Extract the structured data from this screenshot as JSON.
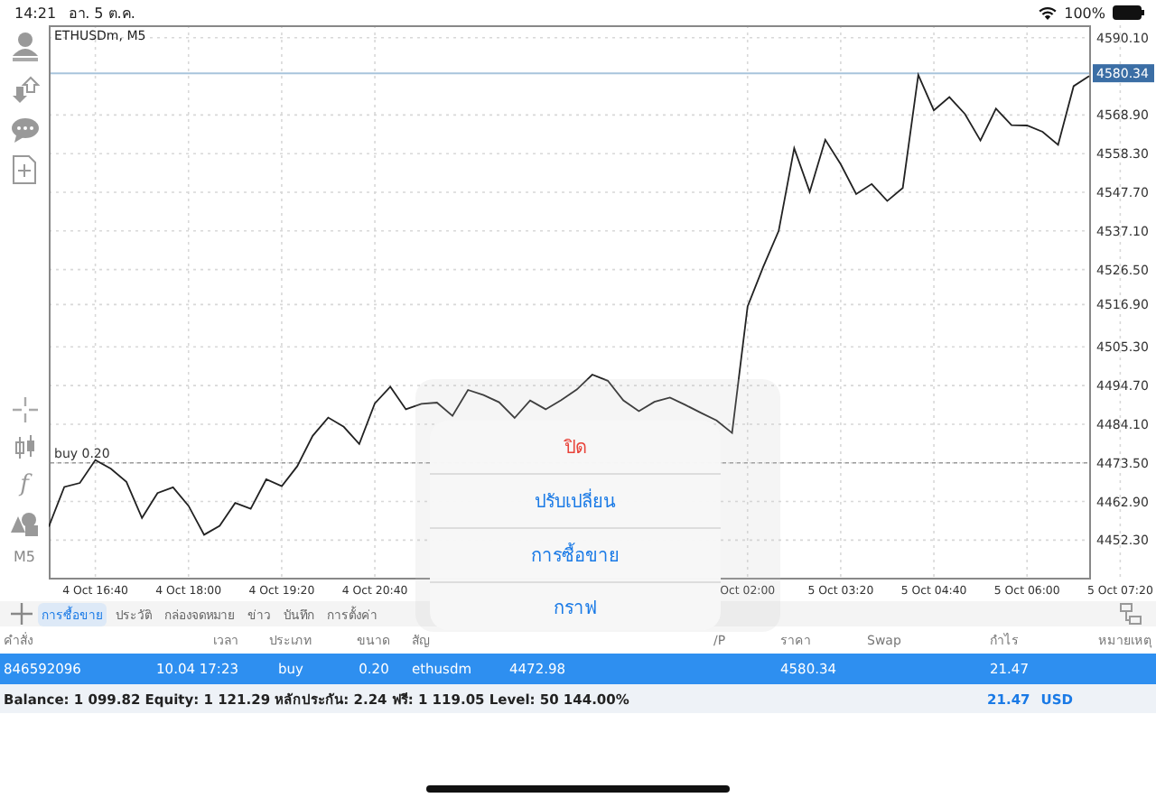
{
  "status_bar": {
    "time": "14:21",
    "date": "อา. 5 ต.ค.",
    "battery": "100%"
  },
  "left_toolbar": {
    "function_glyph": "f",
    "timeframe": "M5"
  },
  "chart": {
    "chart_data": {
      "type": "line",
      "title": "ETHUSDm, M5",
      "grid": true,
      "ylim": [
        4442,
        4593
      ],
      "categories": [
        null,
        null,
        null,
        "4 Oct 16:40",
        null,
        null,
        null,
        null,
        null,
        "4 Oct 18:00",
        null,
        null,
        null,
        null,
        null,
        "4 Oct 19:20",
        null,
        null,
        null,
        null,
        null,
        "4 Oct 20:40",
        null,
        null,
        null,
        null,
        null,
        null,
        null,
        null,
        null,
        null,
        null,
        null,
        null,
        null,
        null,
        null,
        null,
        null,
        null,
        null,
        null,
        null,
        null,
        "Oct 02:00",
        null,
        null,
        null,
        null,
        null,
        "5 Oct 03:20",
        null,
        null,
        null,
        null,
        null,
        "5 Oct 04:40",
        null,
        null,
        null,
        null,
        null,
        "5 Oct 06:00",
        null,
        null,
        null,
        null,
        null,
        "5 Oct 07:20"
      ],
      "yticks": [
        {
          "value": 4590.1,
          "label": "4590.10"
        },
        {
          "value": 4568.9,
          "label": "4568.90"
        },
        {
          "value": 4558.3,
          "label": "4558.30"
        },
        {
          "value": 4547.7,
          "label": "4547.70"
        },
        {
          "value": 4537.1,
          "label": "4537.10"
        },
        {
          "value": 4526.5,
          "label": "4526.50"
        },
        {
          "value": 4516.9,
          "label": "4516.90"
        },
        {
          "value": 4505.3,
          "label": "4505.30"
        },
        {
          "value": 4494.7,
          "label": "4494.70"
        },
        {
          "value": 4484.1,
          "label": "4484.10"
        },
        {
          "value": 4473.5,
          "label": "4473.50"
        },
        {
          "value": 4462.9,
          "label": "4462.90"
        },
        {
          "value": 4452.3,
          "label": "4452.30"
        }
      ],
      "ref_lines": [
        {
          "axis": "y",
          "value": 4473.5,
          "label": "buy 0.20"
        },
        {
          "axis": "y",
          "value": 4580.34,
          "label": "4580.34"
        }
      ],
      "series": [
        {
          "color": "#222222",
          "values": [
            4456.0,
            4466.9,
            4468.0,
            4474.3,
            4471.9,
            4468.3,
            4458.4,
            4465.2,
            4466.8,
            4461.7,
            4453.8,
            4456.2,
            4462.5,
            4460.9,
            4469.0,
            4467.1,
            4472.6,
            4480.9,
            4485.9,
            4483.4,
            4478.7,
            4489.8,
            4494.4,
            4488.2,
            4489.7,
            4490.0,
            4486.4,
            4493.5,
            4492.1,
            4490.1,
            4485.8,
            4490.6,
            4488.2,
            4490.7,
            4493.6,
            4497.7,
            4496.0,
            4490.6,
            4487.7,
            4490.2,
            4491.4,
            4489.4,
            4487.2,
            4485.1,
            4481.7,
            4516.4,
            4527.2,
            4537.1,
            4559.8,
            4547.8,
            4562.1,
            4555.4,
            4547.2,
            4550.0,
            4545.3,
            4548.9,
            4579.9,
            4570.2,
            4573.8,
            4569.2,
            4561.9,
            4570.6,
            4566.1,
            4566.0,
            4564.3,
            4560.7,
            4576.8,
            4579.6,
            null,
            null
          ]
        }
      ]
    }
  },
  "tabs": [
    {
      "label": "การซื้อขาย",
      "selected": true
    },
    {
      "label": "ประวัติ",
      "selected": false
    },
    {
      "label": "กล่องจดหมาย",
      "selected": false
    },
    {
      "label": "ข่าว",
      "selected": false
    },
    {
      "label": "บันทึก",
      "selected": false
    },
    {
      "label": "การตั้งค่า",
      "selected": false
    }
  ],
  "table": {
    "columns": [
      "คำสั่ง",
      "เวลา",
      "ประเภท",
      "ขนาด",
      "สัญ",
      null,
      null,
      "/P",
      "ราคา",
      "Swap",
      "กำไร",
      "หมายเหตุ"
    ],
    "rows": [
      {
        "selected": true,
        "cells": [
          "846592096",
          "10.04 17:23",
          "buy",
          "0.20",
          "ethusdm",
          "4472.98",
          "",
          "",
          "4580.34",
          "",
          "21.47",
          ""
        ]
      }
    ]
  },
  "summary": {
    "text": "Balance: 1 099.82 Equity: 1 121.29 หลักประกัน: 2.24 ฟรี: 1 119.05 Level: 50 144.00%",
    "profit": "21.47",
    "currency": "USD"
  },
  "action_sheet": [
    {
      "label": "ปิด",
      "kind": "destructive"
    },
    {
      "label": "ปรับเปลี่ยน",
      "kind": "default"
    },
    {
      "label": "การซื้อขาย",
      "kind": "default"
    },
    {
      "label": "กราฟ",
      "kind": "default"
    }
  ]
}
